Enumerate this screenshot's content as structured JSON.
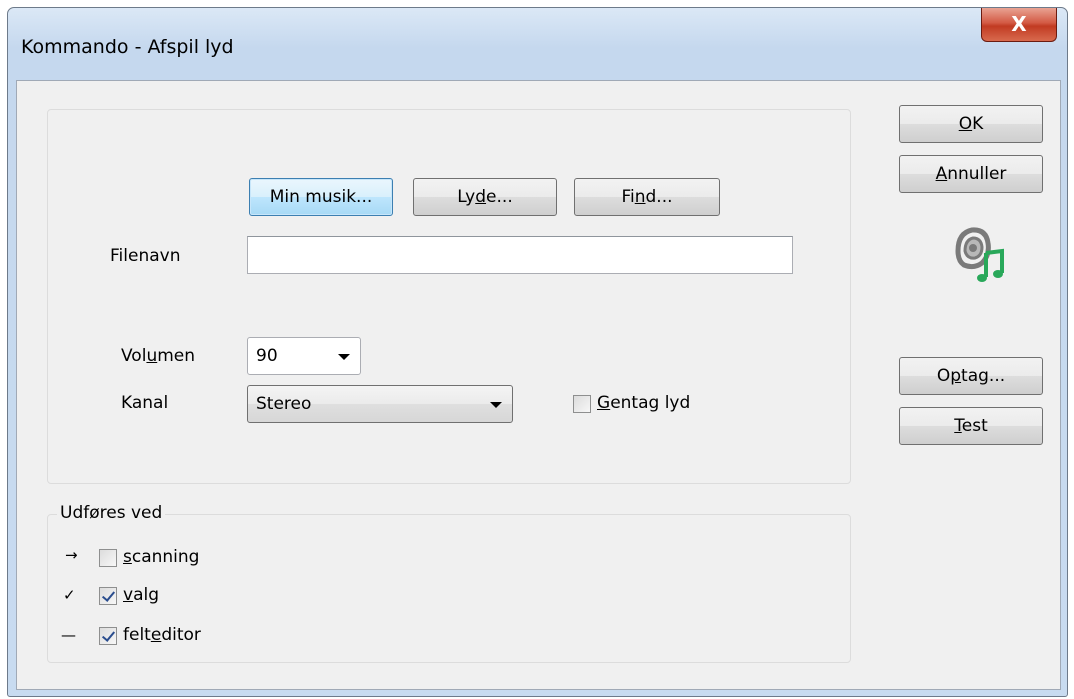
{
  "window": {
    "title": "Kommando - Afspil lyd",
    "close_glyph": "X"
  },
  "toolbar_buttons": {
    "my_music": "Min musik...",
    "sounds_pre": "Ly",
    "sounds_u": "d",
    "sounds_post": "e...",
    "find_pre": "Fi",
    "find_u": "n",
    "find_post": "d..."
  },
  "file": {
    "label": "Filenavn",
    "value": ""
  },
  "volume": {
    "label_pre": "Vol",
    "label_u": "u",
    "label_post": "men",
    "value": "90"
  },
  "channel": {
    "label": "Kanal",
    "value": "Stereo"
  },
  "repeat": {
    "label_u": "G",
    "label_post": "entag lyd",
    "checked": false
  },
  "side_buttons": {
    "ok_u": "O",
    "ok_post": "K",
    "cancel_u": "A",
    "cancel_post": "nnuller",
    "record_pre": "O",
    "record_u": "p",
    "record_post": "tag...",
    "test_u": "T",
    "test_post": "est"
  },
  "icons": {
    "speaker": "speaker-music-icon",
    "speaker_color": "#7a7a7a",
    "note_color": "#29a85a"
  },
  "execute_group": {
    "legend": "Udføres ved",
    "items": [
      {
        "marker": "→",
        "label_u": "s",
        "label_post": "canning",
        "checked": false
      },
      {
        "marker": "✓",
        "label_u": "v",
        "label_post": "alg",
        "checked": true
      },
      {
        "marker": "—",
        "label_pre": "felt",
        "label_u": "e",
        "label_post": "ditor",
        "checked": true
      }
    ]
  }
}
